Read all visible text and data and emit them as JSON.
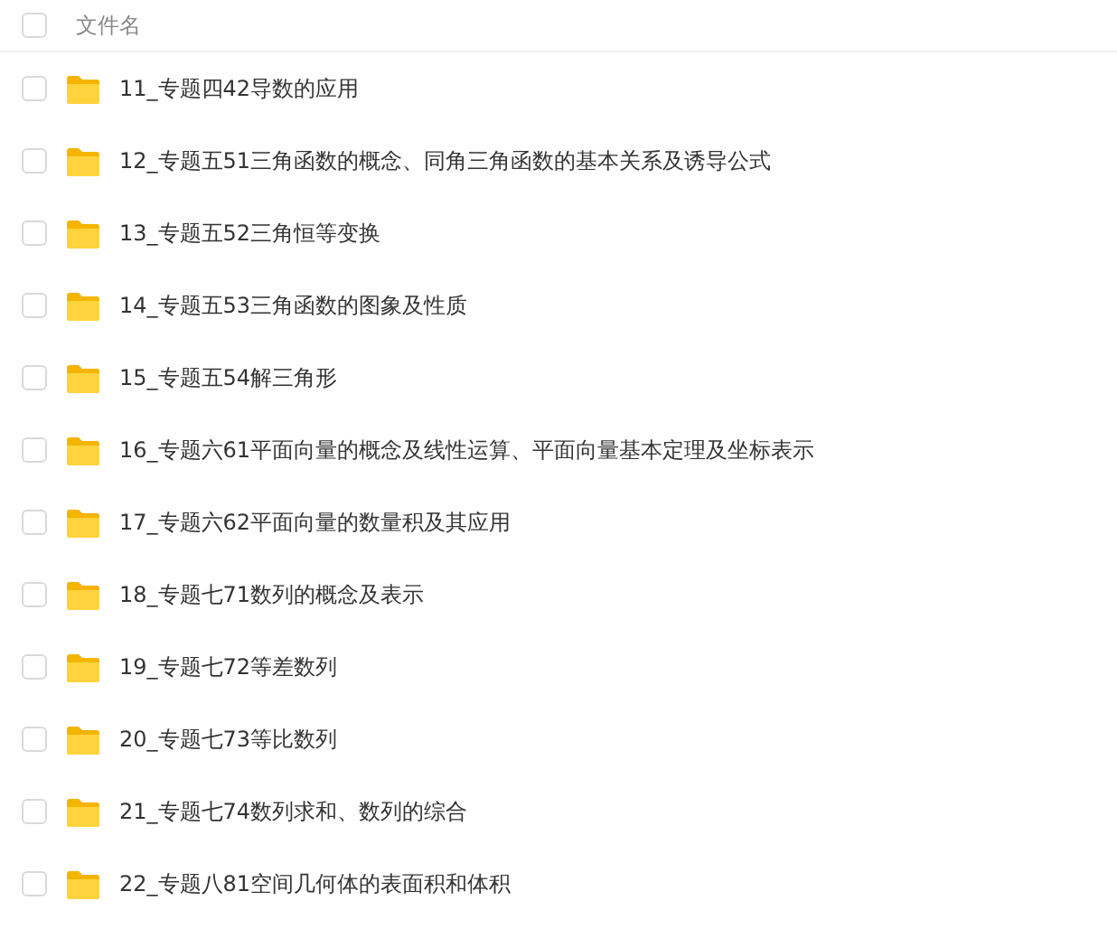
{
  "header": {
    "checked": false,
    "label": "文件名"
  },
  "files": [
    {
      "name": "11_专题四42导数的应用",
      "checked": false
    },
    {
      "name": "12_专题五51三角函数的概念、同角三角函数的基本关系及诱导公式",
      "checked": false
    },
    {
      "name": "13_专题五52三角恒等变换",
      "checked": false
    },
    {
      "name": "14_专题五53三角函数的图象及性质",
      "checked": false
    },
    {
      "name": "15_专题五54解三角形",
      "checked": false
    },
    {
      "name": "16_专题六61平面向量的概念及线性运算、平面向量基本定理及坐标表示",
      "checked": false
    },
    {
      "name": "17_专题六62平面向量的数量积及其应用",
      "checked": false
    },
    {
      "name": "18_专题七71数列的概念及表示",
      "checked": false
    },
    {
      "name": "19_专题七72等差数列",
      "checked": false
    },
    {
      "name": "20_专题七73等比数列",
      "checked": false
    },
    {
      "name": "21_专题七74数列求和、数列的综合",
      "checked": false
    },
    {
      "name": "22_专题八81空间几何体的表面积和体积",
      "checked": false
    }
  ]
}
